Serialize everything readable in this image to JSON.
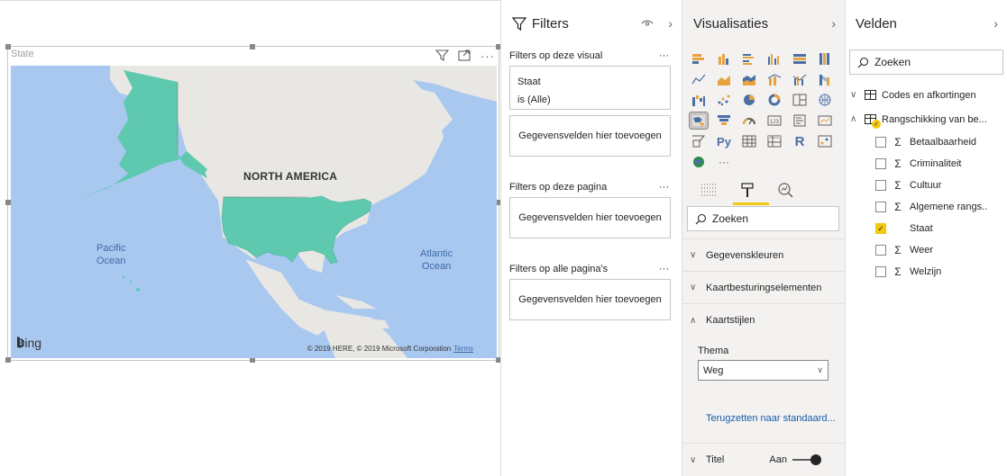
{
  "visual": {
    "title": "State",
    "map_label": "NORTH AMERICA",
    "pacific_line1": "Pacific",
    "pacific_line2": "Ocean",
    "atlantic_line1": "Atlantic",
    "atlantic_line2": "Ocean",
    "bing": "Bing",
    "copyright": "© 2019 HERE, © 2019 Microsoft Corporation",
    "terms": "Terms",
    "fill_color": "#5fc9b0",
    "land_color": "#e8e7e3",
    "water_color": "#a9c8f0"
  },
  "filters": {
    "title": "Filters",
    "sections": {
      "visual": "Filters op deze visual",
      "page": "Filters op deze pagina",
      "all_pages": "Filters op alle pagina's"
    },
    "staat_card": {
      "field": "Staat",
      "value": "is (Alle)"
    },
    "add_fields": "Gegevensvelden hier toevoegen",
    "more": "···"
  },
  "visualizations": {
    "title": "Visualisaties",
    "search_placeholder": "Zoeken",
    "accordions": {
      "data_colors": "Gegevenskleuren",
      "map_controls": "Kaartbesturingselementen",
      "map_styles": "Kaartstijlen"
    },
    "theme_label": "Thema",
    "theme_value": "Weg",
    "reset_link": "Terugzetten naar standaard...",
    "title_row": "Titel",
    "title_toggle": "Aan",
    "more": "···"
  },
  "fields": {
    "title": "Velden",
    "search_placeholder": "Zoeken",
    "tables": [
      {
        "name": "Codes en afkortingen"
      },
      {
        "name": "Rangschikking van be..."
      }
    ],
    "items": [
      {
        "name": "Betaalbaarheid",
        "sigma": "Σ",
        "checked": false
      },
      {
        "name": "Criminaliteit",
        "sigma": "Σ",
        "checked": false
      },
      {
        "name": "Cultuur",
        "sigma": "Σ",
        "checked": false
      },
      {
        "name": "Algemene rangs..",
        "sigma": "Σ",
        "checked": false
      },
      {
        "name": "Staat",
        "sigma": "",
        "checked": true
      },
      {
        "name": "Weer",
        "sigma": "Σ",
        "checked": false
      },
      {
        "name": "Welzijn",
        "sigma": "Σ",
        "checked": false
      }
    ]
  }
}
